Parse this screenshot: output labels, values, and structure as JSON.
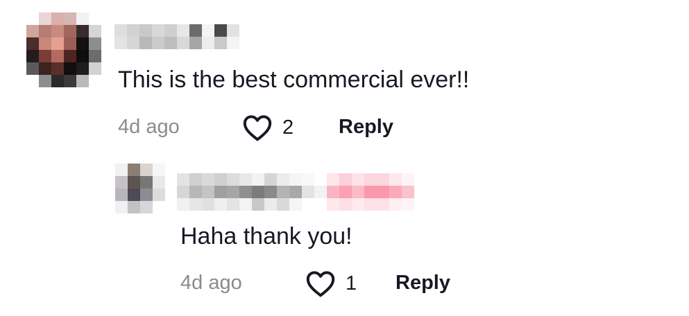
{
  "comments": [
    {
      "text": "This is the best commercial ever!!",
      "time": "4d ago",
      "likes": "2",
      "reply_label": "Reply",
      "username_redacted": true,
      "avatar_redacted": true
    },
    {
      "text": "Haha thank you!",
      "time": "4d ago",
      "likes": "1",
      "reply_label": "Reply",
      "username_redacted": true,
      "avatar_redacted": true,
      "is_reply": true
    }
  ],
  "icons": {
    "like": "heart-outline-icon"
  },
  "colors": {
    "text": "#161823",
    "muted": "#8a8b91",
    "creator_badge": "#fe2c55"
  }
}
